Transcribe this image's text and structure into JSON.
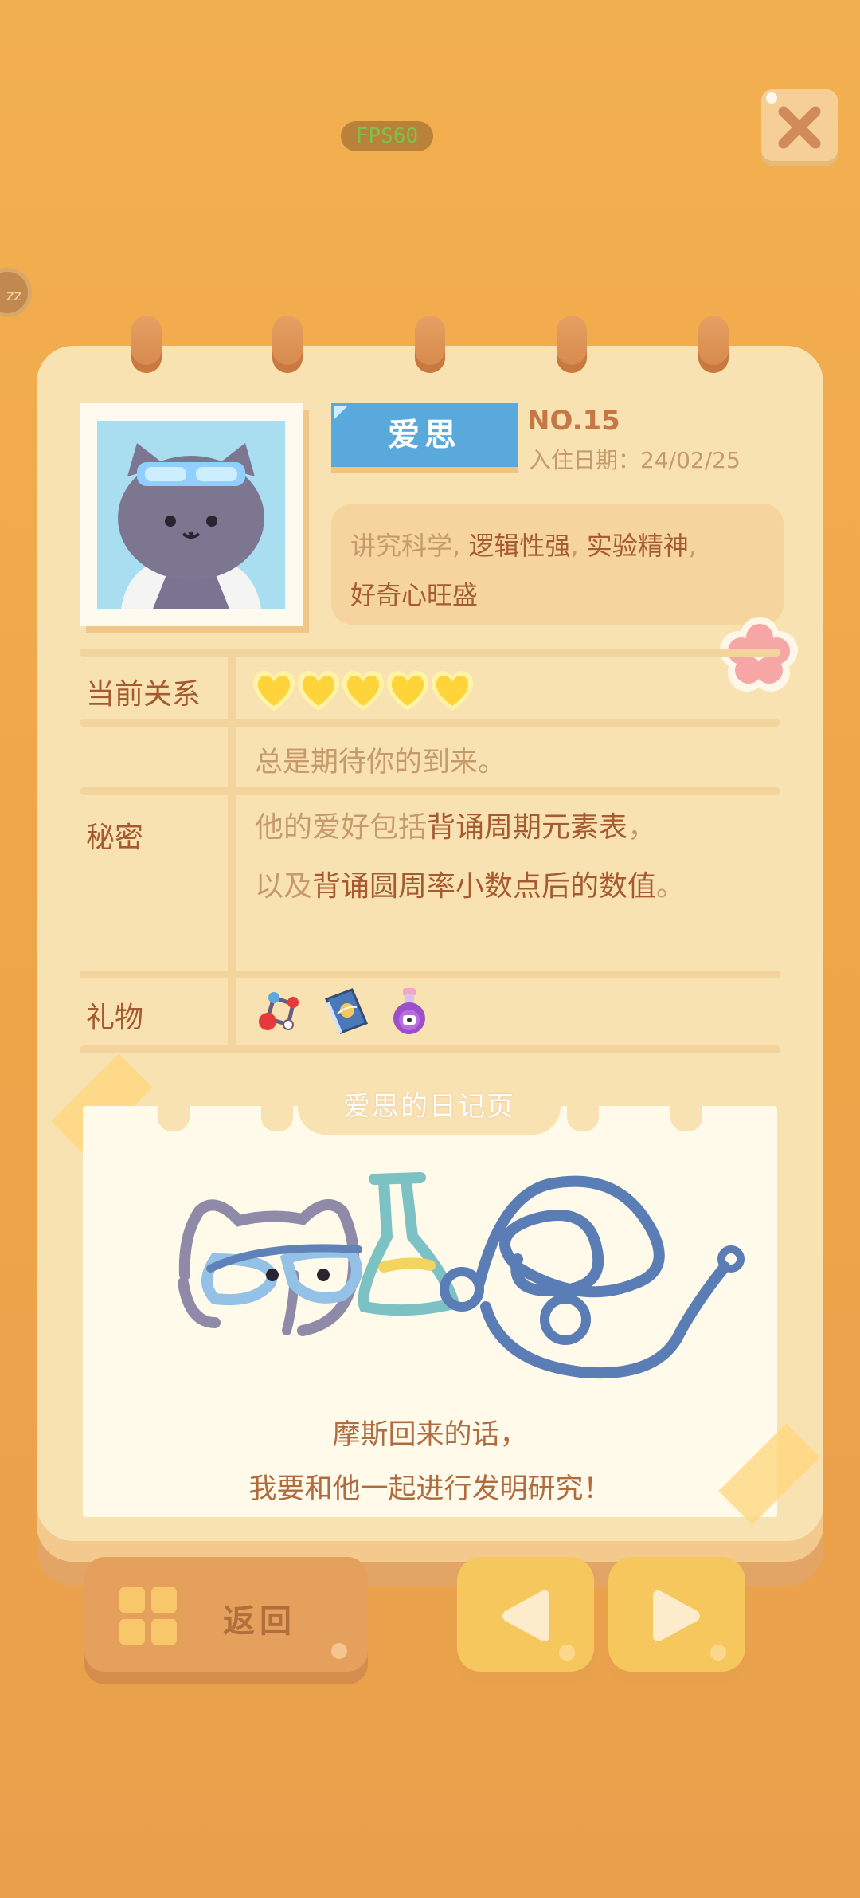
{
  "hud": {
    "fps": "FPS60",
    "sleep_label": "zz"
  },
  "character": {
    "name": "爱思",
    "number": "NO.15",
    "join_date": "入住日期：24/02/25",
    "desc_plain": "讲究科学, ",
    "desc_strong_1": "逻辑性强",
    "desc_sep": ", ",
    "desc_strong_2": "实验精神",
    "desc_end": ",",
    "desc_line2": "好奇心旺盛"
  },
  "profile": {
    "relation_label": "当前关系",
    "relation_hearts": 5,
    "relation_text": "总是期待你的到来。",
    "secret_label": "秘密",
    "secret_line1_plain": "他的爱好包括",
    "secret_line1_strong": "背诵周期元素表",
    "secret_line1_end": "，",
    "secret_line2_plain": "以及",
    "secret_line2_strong": "背诵圆周率小数点后的数值",
    "secret_line2_end": "。",
    "gift_label": "礼物",
    "gifts": [
      "molecule-model-icon",
      "science-book-icon",
      "potion-bottle-icon"
    ]
  },
  "diary": {
    "title": "爱思的日记页",
    "line1": "摩斯回来的话，",
    "line2": "我要和他一起进行发明研究！"
  },
  "buttons": {
    "back_label": "返回"
  },
  "colors": {
    "background": "#efa64a",
    "page": "#f9e2b2",
    "name_tag": "#5aa9dc",
    "heart": "#ffd43b",
    "accent_text": "#a65a30"
  }
}
